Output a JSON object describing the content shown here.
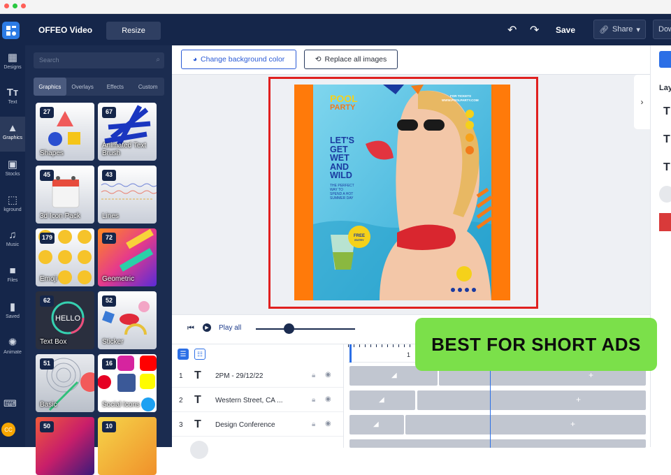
{
  "app": {
    "title": "OFFEO Video",
    "resize_label": "Resize",
    "save_label": "Save",
    "share_label": "Share",
    "download_label": "Dow"
  },
  "rail": [
    {
      "label": "Designs",
      "icon": "layout-icon"
    },
    {
      "label": "Text",
      "icon": "text-icon"
    },
    {
      "label": "Graphics",
      "icon": "shapes-icon"
    },
    {
      "label": "Stocks",
      "icon": "image-icon"
    },
    {
      "label": "kground",
      "icon": "background-icon"
    },
    {
      "label": "Music",
      "icon": "music-icon"
    },
    {
      "label": "Files",
      "icon": "folder-icon"
    },
    {
      "label": "Saved",
      "icon": "bookmark-icon"
    },
    {
      "label": "Animate",
      "icon": "sparkle-icon"
    }
  ],
  "avatar": "CC",
  "panel": {
    "search_placeholder": "Search",
    "tabs": [
      "Graphics",
      "Overlays",
      "Effects",
      "Custom"
    ],
    "cards": [
      {
        "count": "27",
        "name": "Shapes"
      },
      {
        "count": "67",
        "name": "Animated Text Brush"
      },
      {
        "count": "45",
        "name": "3d Icon Pack"
      },
      {
        "count": "43",
        "name": "Lines"
      },
      {
        "count": "179",
        "name": "Emoji"
      },
      {
        "count": "72",
        "name": "Geometric"
      },
      {
        "count": "62",
        "name": "Text Box"
      },
      {
        "count": "52",
        "name": "Sticker"
      },
      {
        "count": "51",
        "name": "Basic"
      },
      {
        "count": "16",
        "name": "Social Icons"
      },
      {
        "count": "50",
        "name": ""
      },
      {
        "count": "10",
        "name": ""
      }
    ]
  },
  "toolbar": {
    "change_bg": "Change background color",
    "replace_images": "Replace all images"
  },
  "poster": {
    "title1": "POOL",
    "title2": "PARTY",
    "tickets": "FOR TICKETS",
    "url": "WWW.POOLPARTY.COM",
    "headline": [
      "LET'S",
      "GET",
      "WET",
      "AND",
      "WILD"
    ],
    "sub": [
      "THE PERFECT",
      "WAY TO",
      "SPEND A HOT",
      "SUMMER DAY"
    ],
    "free1": "FREE",
    "free2": "ENTRY"
  },
  "timeline": {
    "play_all": "Play all",
    "ruler_mark": "1",
    "rows": [
      {
        "num": "1",
        "label": "2PM - 29/12/22"
      },
      {
        "num": "2",
        "label": "Western Street, CA ..."
      },
      {
        "num": "3",
        "label": "Design Conference"
      }
    ]
  },
  "right_panel": {
    "heading": "Lay"
  },
  "overlay_badge": "BEST FOR SHORT ADS"
}
